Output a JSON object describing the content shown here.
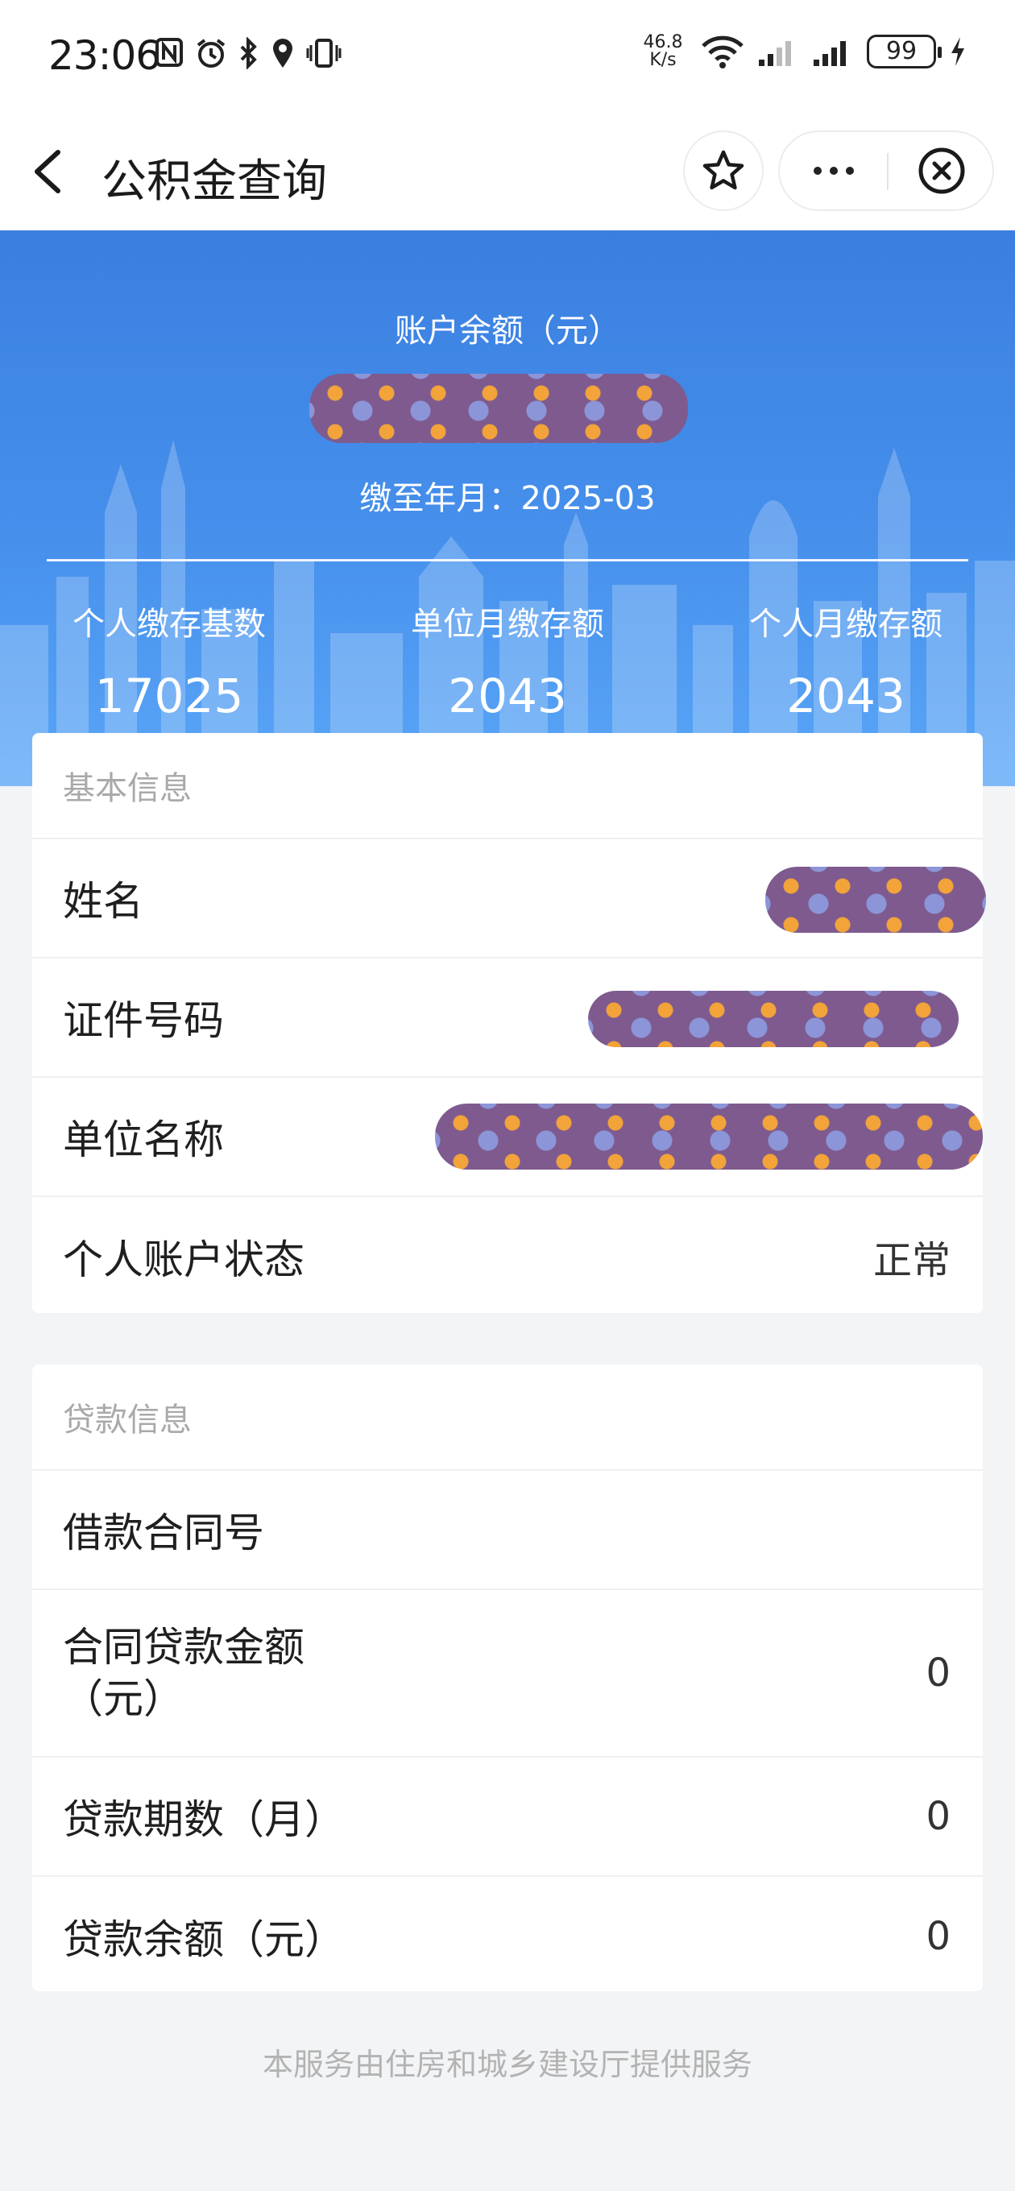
{
  "status_bar": {
    "time": "23:06",
    "net_speed_value": "46.8",
    "net_speed_unit": "K/s",
    "battery": "99",
    "icons": [
      "nfc-icon",
      "alarm-icon",
      "bluetooth-icon",
      "location-icon",
      "vibrate-icon",
      "wifi-icon",
      "signal-icon",
      "signal-icon",
      "charging-icon"
    ]
  },
  "nav": {
    "title": "公积金查询",
    "icons": [
      "back-icon",
      "star-icon",
      "more-icon",
      "close-icon"
    ]
  },
  "summary": {
    "balance_label": "账户余额（元）",
    "paid_until": "缴至年月：2025-03",
    "stats": [
      {
        "label": "个人缴存基数",
        "value": "17025"
      },
      {
        "label": "单位月缴存额",
        "value": "2043"
      },
      {
        "label": "个人月缴存额",
        "value": "2043"
      }
    ]
  },
  "basic_info": {
    "title": "基本信息",
    "name_label": "姓名",
    "id_label": "证件号码",
    "org_label": "单位名称",
    "status_label": "个人账户状态",
    "status_value": "正常"
  },
  "loan_info": {
    "title": "贷款信息",
    "rows": [
      {
        "label": "借款合同号",
        "value": ""
      },
      {
        "label": "合同贷款金额（元）",
        "value": "0"
      },
      {
        "label": "贷款期数（月）",
        "value": "0"
      },
      {
        "label": "贷款余额（元）",
        "value": "0"
      }
    ]
  },
  "footer": "本服务由住房和城乡建设厅提供服务",
  "colors": {
    "hero_top": "#3a7fe0",
    "hero_bottom": "#5aa6f7",
    "page_bg": "#f3f4f6",
    "redaction": "#7e5a8e"
  }
}
